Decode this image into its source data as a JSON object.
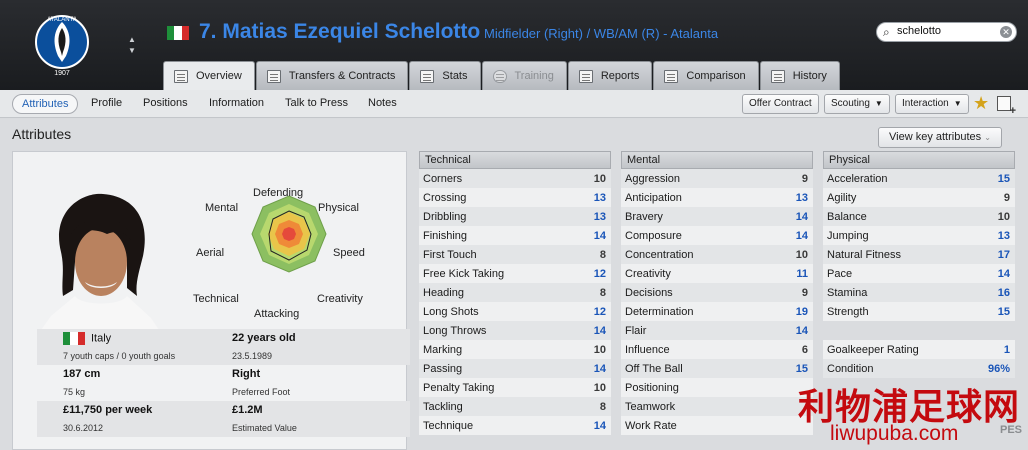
{
  "header": {
    "club_crest": "atalanta-crest-icon",
    "crest_text": "ATALANTA",
    "crest_year": "1907",
    "player_title": "7. Matias Ezequiel Schelotto",
    "player_subtitle": "Midfielder (Right) / WB/AM (R) - Atalanta",
    "search_value": "schelotto",
    "flag_colors": [
      "#1e8f3a",
      "#ffffff",
      "#d52b2b"
    ]
  },
  "tabs": [
    {
      "label": "Overview",
      "icon": "overview-icon"
    },
    {
      "label": "Transfers & Contracts",
      "icon": "contract-icon"
    },
    {
      "label": "Stats",
      "icon": "stats-icon"
    },
    {
      "label": "Training",
      "icon": "training-icon"
    },
    {
      "label": "Reports",
      "icon": "reports-icon"
    },
    {
      "label": "Comparison",
      "icon": "comparison-icon"
    },
    {
      "label": "History",
      "icon": "history-icon"
    }
  ],
  "subnav": {
    "items": [
      "Attributes",
      "Profile",
      "Positions",
      "Information",
      "Talk to Press",
      "Notes"
    ],
    "offer_contract": "Offer Contract",
    "scouting": "Scouting",
    "interaction": "Interaction"
  },
  "section_title": "Attributes",
  "view_key_attributes": "View key attributes",
  "radar_labels": {
    "defending": "Defending",
    "physical": "Physical",
    "speed": "Speed",
    "creativity": "Creativity",
    "attacking": "Attacking",
    "technical": "Technical",
    "aerial": "Aerial",
    "mental": "Mental"
  },
  "bio": {
    "nation": "Italy",
    "caps": "7 youth caps / 0 youth goals",
    "age": "22 years old",
    "dob": "23.5.1989",
    "height": "187 cm",
    "weight": "75 kg",
    "foot": "Right",
    "foot_label": "Preferred Foot",
    "wage": "£11,750 per week",
    "contract_end": "30.6.2012",
    "value": "£1.2M",
    "value_label": "Estimated Value"
  },
  "technical": {
    "header": "Technical",
    "rows": [
      {
        "name": "Corners",
        "value": "10"
      },
      {
        "name": "Crossing",
        "value": "13"
      },
      {
        "name": "Dribbling",
        "value": "13"
      },
      {
        "name": "Finishing",
        "value": "14"
      },
      {
        "name": "First Touch",
        "value": "8"
      },
      {
        "name": "Free Kick Taking",
        "value": "12"
      },
      {
        "name": "Heading",
        "value": "8"
      },
      {
        "name": "Long Shots",
        "value": "12"
      },
      {
        "name": "Long Throws",
        "value": "14"
      },
      {
        "name": "Marking",
        "value": "10"
      },
      {
        "name": "Passing",
        "value": "14"
      },
      {
        "name": "Penalty Taking",
        "value": "10"
      },
      {
        "name": "Tackling",
        "value": "8"
      },
      {
        "name": "Technique",
        "value": "14"
      }
    ]
  },
  "mental": {
    "header": "Mental",
    "rows": [
      {
        "name": "Aggression",
        "value": "9"
      },
      {
        "name": "Anticipation",
        "value": "13"
      },
      {
        "name": "Bravery",
        "value": "14"
      },
      {
        "name": "Composure",
        "value": "14"
      },
      {
        "name": "Concentration",
        "value": "10"
      },
      {
        "name": "Creativity",
        "value": "11"
      },
      {
        "name": "Decisions",
        "value": "9"
      },
      {
        "name": "Determination",
        "value": "19"
      },
      {
        "name": "Flair",
        "value": "14"
      },
      {
        "name": "Influence",
        "value": "6"
      },
      {
        "name": "Off The Ball",
        "value": "15"
      },
      {
        "name": "Positioning",
        "value": ""
      },
      {
        "name": "Teamwork",
        "value": ""
      },
      {
        "name": "Work Rate",
        "value": ""
      }
    ]
  },
  "physical": {
    "header": "Physical",
    "rows": [
      {
        "name": "Acceleration",
        "value": "15"
      },
      {
        "name": "Agility",
        "value": "9"
      },
      {
        "name": "Balance",
        "value": "10"
      },
      {
        "name": "Jumping",
        "value": "13"
      },
      {
        "name": "Natural Fitness",
        "value": "17"
      },
      {
        "name": "Pace",
        "value": "14"
      },
      {
        "name": "Stamina",
        "value": "16"
      },
      {
        "name": "Strength",
        "value": "15"
      }
    ],
    "goalkeeper_label": "Goalkeeper Rating",
    "goalkeeper_value": "1",
    "condition_label": "Condition",
    "condition_value": "96%"
  },
  "watermark": {
    "chinese": "利物浦足球网",
    "domain": "liwupuba.com",
    "corner": "PES"
  }
}
